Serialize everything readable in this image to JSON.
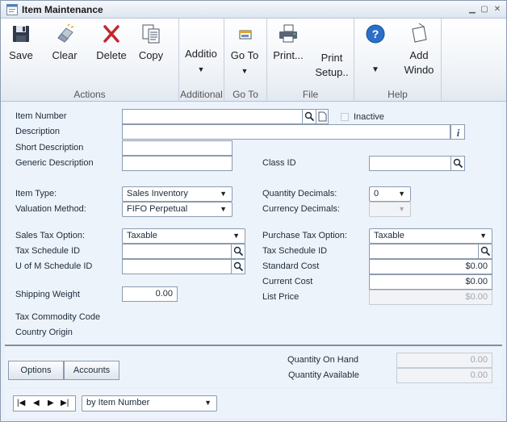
{
  "window": {
    "title": "Item Maintenance"
  },
  "ribbon": {
    "groups": [
      {
        "label": "Actions"
      },
      {
        "label": "Additional"
      },
      {
        "label": "Go To"
      },
      {
        "label": "File"
      },
      {
        "label": "Help"
      }
    ],
    "buttons": {
      "save": "Save",
      "clear": "Clear",
      "delete": "Delete",
      "copy": "Copy",
      "additional": "Additio",
      "goto": "Go To",
      "print": "Print...",
      "print_setup_1": "Print",
      "print_setup_2": "Setup..",
      "add_window_1": "Add",
      "add_window_2": "Windo"
    },
    "icons": {
      "save": "floppy-disk-icon",
      "clear": "eraser-icon",
      "delete": "red-x-icon",
      "copy": "copy-documents-icon",
      "goto": "window-goto-icon",
      "print": "printer-icon",
      "help": "help-question-icon",
      "add_window": "add-window-icon"
    },
    "colors": {
      "delete": "#c0282d",
      "help": "#2c6fc9"
    }
  },
  "form": {
    "labels": {
      "item_number": "Item Number",
      "inactive": "Inactive",
      "description": "Description",
      "short_description": "Short Description",
      "generic_description": "Generic Description",
      "class_id": "Class ID",
      "item_type": "Item Type:",
      "valuation_method": "Valuation Method:",
      "quantity_decimals": "Quantity Decimals:",
      "currency_decimals": "Currency Decimals:",
      "sales_tax_option": "Sales Tax Option:",
      "sales_tax_schedule_id": "Tax Schedule ID",
      "uofm_schedule_id": "U of M Schedule ID",
      "purchase_tax_option": "Purchase Tax Option:",
      "purchase_tax_schedule_id": "Tax Schedule ID",
      "standard_cost": "Standard Cost",
      "current_cost": "Current Cost",
      "list_price": "List Price",
      "shipping_weight": "Shipping Weight",
      "tax_commodity_code": "Tax Commodity Code",
      "country_origin": "Country Origin"
    },
    "values": {
      "item_number": "",
      "description": "",
      "short_description": "",
      "generic_description": "",
      "class_id": "",
      "item_type": "Sales Inventory",
      "valuation_method": "FIFO Perpetual",
      "quantity_decimals": "0",
      "currency_decimals": "",
      "sales_tax_option": "Taxable",
      "sales_tax_schedule_id": "",
      "uofm_schedule_id": "",
      "purchase_tax_option": "Taxable",
      "purchase_tax_schedule_id": "",
      "standard_cost": "$0.00",
      "current_cost": "$0.00",
      "list_price": "$0.00",
      "shipping_weight": "0.00"
    }
  },
  "bottom": {
    "options_button": "Options",
    "accounts_button": "Accounts",
    "quantity_on_hand_label": "Quantity On Hand",
    "quantity_on_hand": "0.00",
    "quantity_available_label": "Quantity Available",
    "quantity_available": "0.00"
  },
  "navigation": {
    "sort_by": "by Item Number"
  }
}
